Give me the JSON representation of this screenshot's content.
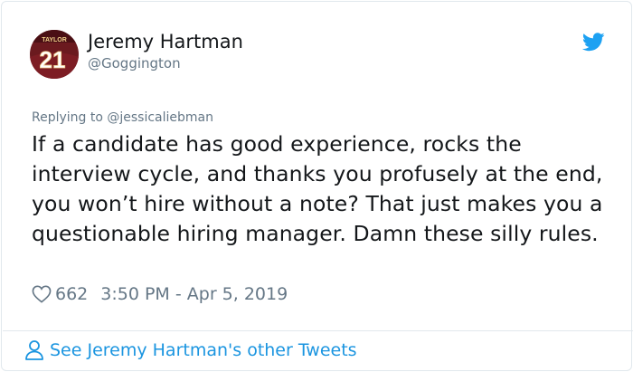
{
  "tweet": {
    "author": {
      "name": "Jeremy Hartman",
      "handle": "@Goggington",
      "avatar": {
        "jersey_text": "TAYLOR",
        "jersey_number": "21"
      }
    },
    "replying_to": "Replying to @jessicaliebman",
    "text": "If a candidate has good experience, rocks the interview cycle, and thanks you profusely at the end, you won’t hire without a note? That just makes you a questionable hiring manager. Damn these silly rules.",
    "like_count": "662",
    "timestamp": "3:50 PM - Apr 5, 2019"
  },
  "footer": {
    "see_more_label": "See Jeremy Hartman's other Tweets"
  },
  "colors": {
    "brand_blue": "#1da1f2",
    "link_blue": "#1b95e0",
    "muted": "#657786",
    "text": "#14171a",
    "border": "#e1e8ed"
  },
  "icons": [
    "twitter-bird-icon",
    "heart-icon",
    "person-icon"
  ]
}
